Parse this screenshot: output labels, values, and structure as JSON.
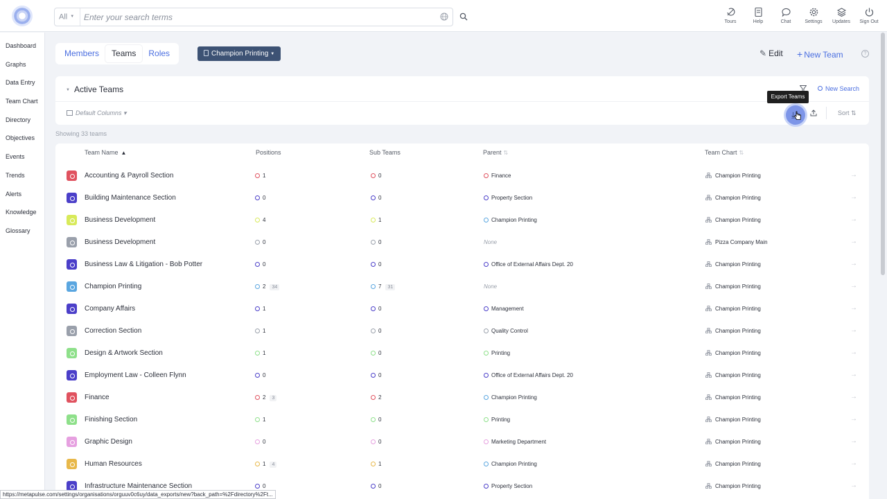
{
  "search": {
    "scope": "All",
    "placeholder": "Enter your search terms"
  },
  "topnav": [
    {
      "label": "Tours",
      "icon": "tours-icon"
    },
    {
      "label": "Help",
      "icon": "help-icon"
    },
    {
      "label": "Chat",
      "icon": "chat-icon"
    },
    {
      "label": "Settings",
      "icon": "settings-icon"
    },
    {
      "label": "Updates",
      "icon": "updates-icon"
    },
    {
      "label": "Sign Out",
      "icon": "sign-out-icon"
    }
  ],
  "sidebar": {
    "items": [
      "Dashboard",
      "Graphs",
      "Data Entry",
      "Team Chart",
      "Directory",
      "Objectives",
      "Events",
      "Trends",
      "Alerts",
      "Knowledge",
      "Glossary"
    ]
  },
  "tabs": [
    "Members",
    "Teams",
    "Roles"
  ],
  "chart_selector": "Champion Printing",
  "actions": {
    "edit": "Edit",
    "new_team": "New Team",
    "help": "?"
  },
  "filter": {
    "title": "Active Teams",
    "new_search": "New Search",
    "columns": "Default Columns",
    "sort": "Sort",
    "tooltip": "Export Teams"
  },
  "showing": "Showing 33 teams",
  "table": {
    "headers": {
      "name": "Team Name",
      "positions": "Positions",
      "sub_teams": "Sub Teams",
      "parent": "Parent",
      "team_chart": "Team Chart"
    },
    "rows": [
      {
        "name": "Accounting & Payroll Section",
        "color": "#e0525f",
        "positions": "1",
        "positions_badge": "",
        "sub_teams": "0",
        "sub_badge": "",
        "parent": "Finance",
        "parent_color": "#e0525f",
        "team_chart": "Champion Printing"
      },
      {
        "name": "Building Maintenance Section",
        "color": "#4b3fc9",
        "positions": "0",
        "positions_badge": "",
        "sub_teams": "0",
        "sub_badge": "",
        "parent": "Property Section",
        "parent_color": "#4b3fc9",
        "team_chart": "Champion Printing"
      },
      {
        "name": "Business Development",
        "color": "#d8ea5a",
        "positions": "4",
        "positions_badge": "",
        "sub_teams": "1",
        "sub_badge": "",
        "parent": "Champion Printing",
        "parent_color": "#5aa6e0",
        "team_chart": "Champion Printing"
      },
      {
        "name": "Business Development",
        "color": "#9aa0ab",
        "positions": "0",
        "positions_badge": "",
        "sub_teams": "0",
        "sub_badge": "",
        "parent": "None",
        "parent_color": "",
        "team_chart": "Pizza Company Main"
      },
      {
        "name": "Business Law & Litigation - Bob Potter",
        "color": "#4b3fc9",
        "positions": "0",
        "positions_badge": "",
        "sub_teams": "0",
        "sub_badge": "",
        "parent": "Office of External Affairs Dept. 20",
        "parent_color": "#4b3fc9",
        "team_chart": "Champion Printing"
      },
      {
        "name": "Champion Printing",
        "color": "#5aa6e0",
        "positions": "2",
        "positions_badge": "34",
        "sub_teams": "7",
        "sub_badge": "31",
        "parent": "None",
        "parent_color": "",
        "team_chart": "Champion Printing"
      },
      {
        "name": "Company Affairs",
        "color": "#4b3fc9",
        "positions": "1",
        "positions_badge": "",
        "sub_teams": "0",
        "sub_badge": "",
        "parent": "Management",
        "parent_color": "#4b3fc9",
        "team_chart": "Champion Printing"
      },
      {
        "name": "Correction Section",
        "color": "#9aa0ab",
        "positions": "1",
        "positions_badge": "",
        "sub_teams": "0",
        "sub_badge": "",
        "parent": "Quality Control",
        "parent_color": "#9aa0ab",
        "team_chart": "Champion Printing"
      },
      {
        "name": "Design & Artwork Section",
        "color": "#8ee08a",
        "positions": "1",
        "positions_badge": "",
        "sub_teams": "0",
        "sub_badge": "",
        "parent": "Printing",
        "parent_color": "#8ee08a",
        "team_chart": "Champion Printing"
      },
      {
        "name": "Employment Law - Colleen Flynn",
        "color": "#4b3fc9",
        "positions": "0",
        "positions_badge": "",
        "sub_teams": "0",
        "sub_badge": "",
        "parent": "Office of External Affairs Dept. 20",
        "parent_color": "#4b3fc9",
        "team_chart": "Champion Printing"
      },
      {
        "name": "Finance",
        "color": "#e0525f",
        "positions": "2",
        "positions_badge": "3",
        "sub_teams": "2",
        "sub_badge": "",
        "parent": "Champion Printing",
        "parent_color": "#5aa6e0",
        "team_chart": "Champion Printing"
      },
      {
        "name": "Finishing Section",
        "color": "#8ee08a",
        "positions": "1",
        "positions_badge": "",
        "sub_teams": "0",
        "sub_badge": "",
        "parent": "Printing",
        "parent_color": "#8ee08a",
        "team_chart": "Champion Printing"
      },
      {
        "name": "Graphic Design",
        "color": "#e6a0e0",
        "positions": "0",
        "positions_badge": "",
        "sub_teams": "0",
        "sub_badge": "",
        "parent": "Marketing Department",
        "parent_color": "#e6a0e0",
        "team_chart": "Champion Printing"
      },
      {
        "name": "Human Resources",
        "color": "#e8b84a",
        "positions": "1",
        "positions_badge": "4",
        "sub_teams": "1",
        "sub_badge": "",
        "parent": "Champion Printing",
        "parent_color": "#5aa6e0",
        "team_chart": "Champion Printing"
      },
      {
        "name": "Infrastructure Maintenance Section",
        "color": "#4b3fc9",
        "positions": "0",
        "positions_badge": "",
        "sub_teams": "0",
        "sub_badge": "",
        "parent": "Property Section",
        "parent_color": "#4b3fc9",
        "team_chart": "Champion Printing"
      }
    ]
  },
  "status_url": "https://metapulse.com/settings/organisations/orguuv0c6uy/data_exports/new?back_path=%2Fdirectory%2Ft..."
}
